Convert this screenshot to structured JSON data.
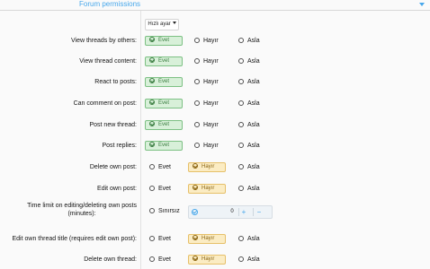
{
  "header": {
    "title": "Forum permissions"
  },
  "quick_set": {
    "label": "Hızlı ayar"
  },
  "options": {
    "yes": "Evet",
    "no": "Hayır",
    "never": "Asla",
    "unlimited": "Sınırsız"
  },
  "rows": [
    {
      "label": "View threads by others:",
      "selected": "yes"
    },
    {
      "label": "View thread content:",
      "selected": "yes"
    },
    {
      "label": "React to posts:",
      "selected": "yes"
    },
    {
      "label": "Can comment on post:",
      "selected": "yes"
    },
    {
      "label": "Post new thread:",
      "selected": "yes"
    },
    {
      "label": "Post replies:",
      "selected": "yes"
    },
    {
      "label": "Delete own post:",
      "selected": "no"
    },
    {
      "label": "Edit own post:",
      "selected": "no"
    },
    {
      "label_line1": "Time limit on editing/deleting own posts",
      "label_line2": "(minutes):",
      "value": "0",
      "plus": "+",
      "minus": "−"
    },
    {
      "label": "Edit own thread title (requires edit own post):",
      "selected": "no"
    },
    {
      "label": "Delete own thread:",
      "selected": "no"
    }
  ],
  "colors": {
    "accent": "#47a7eb",
    "yes_bg": "#d8f0d9",
    "no_bg": "#fbecc3"
  }
}
